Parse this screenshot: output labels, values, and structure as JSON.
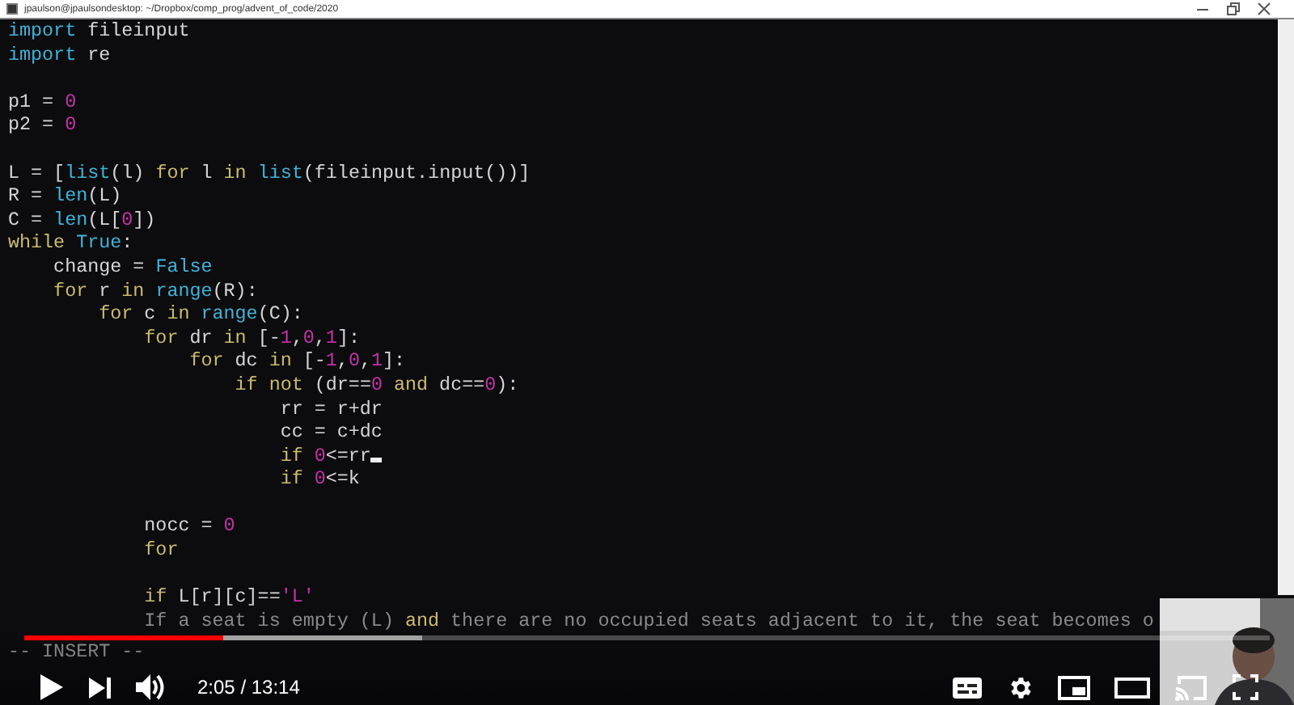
{
  "window": {
    "title": "jpaulson@jpaulsondesktop: ~/Dropbox/comp_prog/advent_of_code/2020"
  },
  "editor": {
    "lines": [
      {
        "kind": "code",
        "cursor": false,
        "tokens": [
          {
            "text": "import",
            "kind": "builtin"
          },
          {
            "text": " fileinput",
            "kind": "plain"
          }
        ]
      },
      {
        "kind": "code",
        "cursor": false,
        "tokens": [
          {
            "text": "import",
            "kind": "builtin"
          },
          {
            "text": " re",
            "kind": "plain"
          }
        ]
      },
      {
        "kind": "blank"
      },
      {
        "kind": "code",
        "cursor": false,
        "tokens": [
          {
            "text": "p1 = ",
            "kind": "plain"
          },
          {
            "text": "0",
            "kind": "literal"
          }
        ]
      },
      {
        "kind": "code",
        "cursor": false,
        "tokens": [
          {
            "text": "p2 = ",
            "kind": "plain"
          },
          {
            "text": "0",
            "kind": "literal"
          }
        ]
      },
      {
        "kind": "blank"
      },
      {
        "kind": "code",
        "cursor": false,
        "tokens": [
          {
            "text": "L = [",
            "kind": "plain"
          },
          {
            "text": "list",
            "kind": "builtin"
          },
          {
            "text": "(l) ",
            "kind": "plain"
          },
          {
            "text": "for",
            "kind": "keyword"
          },
          {
            "text": " l ",
            "kind": "plain"
          },
          {
            "text": "in",
            "kind": "keyword"
          },
          {
            "text": " list",
            "kind": "builtin"
          },
          {
            "text": "(fileinput.input())]",
            "kind": "plain"
          }
        ]
      },
      {
        "kind": "code",
        "cursor": false,
        "tokens": [
          {
            "text": "R = ",
            "kind": "plain"
          },
          {
            "text": "len",
            "kind": "builtin"
          },
          {
            "text": "(L)",
            "kind": "plain"
          }
        ]
      },
      {
        "kind": "code",
        "cursor": false,
        "tokens": [
          {
            "text": "C = ",
            "kind": "plain"
          },
          {
            "text": "len",
            "kind": "builtin"
          },
          {
            "text": "(L[",
            "kind": "plain"
          },
          {
            "text": "0",
            "kind": "literal"
          },
          {
            "text": "])",
            "kind": "plain"
          }
        ]
      },
      {
        "kind": "code",
        "cursor": false,
        "tokens": [
          {
            "text": "while",
            "kind": "keyword"
          },
          {
            "text": " True",
            "kind": "builtin"
          },
          {
            "text": ":",
            "kind": "plain"
          }
        ]
      },
      {
        "kind": "code",
        "cursor": false,
        "tokens": [
          {
            "text": "    change = ",
            "kind": "plain"
          },
          {
            "text": "False",
            "kind": "builtin"
          }
        ]
      },
      {
        "kind": "code",
        "cursor": false,
        "tokens": [
          {
            "text": "    for",
            "kind": "keyword"
          },
          {
            "text": " r ",
            "kind": "plain"
          },
          {
            "text": "in",
            "kind": "keyword"
          },
          {
            "text": " range",
            "kind": "builtin"
          },
          {
            "text": "(R):",
            "kind": "plain"
          }
        ]
      },
      {
        "kind": "code",
        "cursor": false,
        "tokens": [
          {
            "text": "        for",
            "kind": "keyword"
          },
          {
            "text": " c ",
            "kind": "plain"
          },
          {
            "text": "in",
            "kind": "keyword"
          },
          {
            "text": " range",
            "kind": "builtin"
          },
          {
            "text": "(C):",
            "kind": "plain"
          }
        ]
      },
      {
        "kind": "code",
        "cursor": false,
        "tokens": [
          {
            "text": "            for",
            "kind": "keyword"
          },
          {
            "text": " dr ",
            "kind": "plain"
          },
          {
            "text": "in",
            "kind": "keyword"
          },
          {
            "text": " [-",
            "kind": "plain"
          },
          {
            "text": "1",
            "kind": "literal"
          },
          {
            "text": ",",
            "kind": "plain"
          },
          {
            "text": "0",
            "kind": "literal"
          },
          {
            "text": ",",
            "kind": "plain"
          },
          {
            "text": "1",
            "kind": "literal"
          },
          {
            "text": "]:",
            "kind": "plain"
          }
        ]
      },
      {
        "kind": "code",
        "cursor": false,
        "tokens": [
          {
            "text": "                for",
            "kind": "keyword"
          },
          {
            "text": " dc ",
            "kind": "plain"
          },
          {
            "text": "in",
            "kind": "keyword"
          },
          {
            "text": " [-",
            "kind": "plain"
          },
          {
            "text": "1",
            "kind": "literal"
          },
          {
            "text": ",",
            "kind": "plain"
          },
          {
            "text": "0",
            "kind": "literal"
          },
          {
            "text": ",",
            "kind": "plain"
          },
          {
            "text": "1",
            "kind": "literal"
          },
          {
            "text": "]:",
            "kind": "plain"
          }
        ]
      },
      {
        "kind": "code",
        "cursor": false,
        "tokens": [
          {
            "text": "                    if",
            "kind": "keyword"
          },
          {
            "text": " not",
            "kind": "keyword"
          },
          {
            "text": " (dr==",
            "kind": "plain"
          },
          {
            "text": "0",
            "kind": "literal"
          },
          {
            "text": " and",
            "kind": "keyword"
          },
          {
            "text": " dc==",
            "kind": "plain"
          },
          {
            "text": "0",
            "kind": "literal"
          },
          {
            "text": "):",
            "kind": "plain"
          }
        ]
      },
      {
        "kind": "code",
        "cursor": false,
        "tokens": [
          {
            "text": "                        rr = r+dr",
            "kind": "plain"
          }
        ]
      },
      {
        "kind": "code",
        "cursor": false,
        "tokens": [
          {
            "text": "                        cc = c+dc",
            "kind": "plain"
          }
        ]
      },
      {
        "kind": "code",
        "cursor": true,
        "tokens": [
          {
            "text": "                        if",
            "kind": "keyword"
          },
          {
            "text": " 0",
            "kind": "literal"
          },
          {
            "text": "<=rr",
            "kind": "plain"
          }
        ]
      },
      {
        "kind": "code",
        "cursor": false,
        "tokens": [
          {
            "text": "                        if",
            "kind": "keyword"
          },
          {
            "text": " 0",
            "kind": "literal"
          },
          {
            "text": "<=k",
            "kind": "plain"
          }
        ]
      },
      {
        "kind": "blank"
      },
      {
        "kind": "code",
        "cursor": false,
        "tokens": [
          {
            "text": "            nocc = ",
            "kind": "plain"
          },
          {
            "text": "0",
            "kind": "literal"
          }
        ]
      },
      {
        "kind": "code",
        "cursor": false,
        "tokens": [
          {
            "text": "            for",
            "kind": "keyword"
          }
        ]
      },
      {
        "kind": "blank"
      },
      {
        "kind": "code",
        "cursor": false,
        "tokens": [
          {
            "text": "            if",
            "kind": "keyword"
          },
          {
            "text": " L[r][c]==",
            "kind": "plain"
          },
          {
            "text": "'L'",
            "kind": "literal"
          }
        ]
      },
      {
        "kind": "code",
        "cursor": false,
        "tokens": [
          {
            "text": "            If a seat is empty (L) ",
            "kind": "comment"
          },
          {
            "text": "and",
            "kind": "keyword"
          },
          {
            "text": " there are no occupied seats adjacent to it, the seat becomes o",
            "kind": "comment"
          }
        ]
      }
    ],
    "mode": "-- INSERT --"
  },
  "player": {
    "played": {
      "level": 0.16
    },
    "buffered": {
      "level": 0.32
    },
    "time": "2:05 / 13:14"
  }
}
